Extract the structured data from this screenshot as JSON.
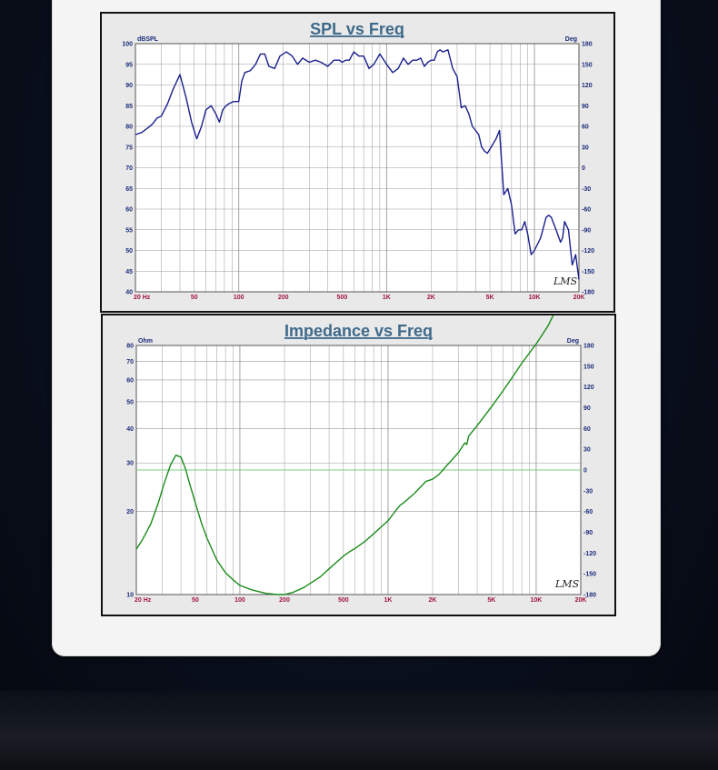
{
  "chart_data": [
    {
      "type": "line",
      "title": "SPL vs Freq",
      "x_scale": "log",
      "xlim": [
        20,
        20000
      ],
      "ylim": [
        40,
        100
      ],
      "y2lim": [
        -180,
        180
      ],
      "y_unit": "dBSPL",
      "y2_unit": "Deg",
      "x_ticks": [
        {
          "value": 20,
          "label": "20 Hz"
        },
        {
          "value": 50,
          "label": "50"
        },
        {
          "value": 100,
          "label": "100"
        },
        {
          "value": 200,
          "label": "200"
        },
        {
          "value": 500,
          "label": "500"
        },
        {
          "value": 1000,
          "label": "1K"
        },
        {
          "value": 2000,
          "label": "2K"
        },
        {
          "value": 5000,
          "label": "5K"
        },
        {
          "value": 10000,
          "label": "10K"
        },
        {
          "value": 20000,
          "label": "20K"
        }
      ],
      "y_ticks": [
        {
          "value": 40,
          "label": "40"
        },
        {
          "value": 45,
          "label": "45"
        },
        {
          "value": 50,
          "label": "50"
        },
        {
          "value": 55,
          "label": "55"
        },
        {
          "value": 60,
          "label": "60"
        },
        {
          "value": 65,
          "label": "65"
        },
        {
          "value": 70,
          "label": "70"
        },
        {
          "value": 75,
          "label": "75"
        },
        {
          "value": 80,
          "label": "80"
        },
        {
          "value": 85,
          "label": "85"
        },
        {
          "value": 90,
          "label": "90"
        },
        {
          "value": 95,
          "label": "95"
        },
        {
          "value": 100,
          "label": "100"
        }
      ],
      "y2_ticks": [
        {
          "value": 180,
          "label": "180"
        },
        {
          "value": 150,
          "label": "150"
        },
        {
          "value": 120,
          "label": "120"
        },
        {
          "value": 90,
          "label": "90"
        },
        {
          "value": 60,
          "label": "60"
        },
        {
          "value": 30,
          "label": "30"
        },
        {
          "value": 0,
          "label": "0"
        },
        {
          "value": -30,
          "label": "-30"
        },
        {
          "value": -60,
          "label": "-60"
        },
        {
          "value": -90,
          "label": "-90"
        },
        {
          "value": -120,
          "label": "-120"
        },
        {
          "value": -150,
          "label": "-150"
        },
        {
          "value": -180,
          "label": "-180"
        }
      ],
      "grid": true,
      "logo": "LMS",
      "colors": {
        "line": "#1a1f8c",
        "grid": "#9a9a9a",
        "plot_bg": "#ffffff"
      },
      "series": [
        {
          "x": [
            20,
            22,
            24,
            26,
            28,
            30,
            33,
            36,
            40,
            44,
            48,
            52,
            56,
            60,
            65,
            70,
            74,
            78,
            82,
            86,
            92,
            100,
            105,
            110,
            120,
            130,
            140,
            150,
            160,
            175,
            190,
            210,
            230,
            250,
            270,
            300,
            330,
            360,
            400,
            440,
            480,
            500,
            530,
            560,
            600,
            650,
            700,
            760,
            820,
            900,
            1000,
            1100,
            1200,
            1300,
            1400,
            1500,
            1600,
            1700,
            1800,
            1900,
            2000,
            2100,
            2200,
            2300,
            2400,
            2600,
            2800,
            3000,
            3200,
            3400,
            3600,
            3800,
            4000,
            4200,
            4400,
            4600,
            4800,
            5000,
            5200,
            5500,
            5800,
            6200,
            6600,
            7000,
            7400,
            7800,
            8200,
            8600,
            9000,
            9500,
            10000,
            11000,
            12000,
            12500,
            13000,
            14000,
            15000,
            15500,
            16000,
            17000,
            18000,
            19000,
            20000
          ],
          "y": [
            78,
            78.5,
            79.5,
            80.5,
            82,
            82.5,
            85.5,
            89,
            92.5,
            87,
            81,
            77,
            80,
            84,
            85,
            83,
            81,
            84,
            85,
            85.5,
            86,
            86,
            91,
            93,
            93.5,
            95,
            97.5,
            97.5,
            94.5,
            94,
            97,
            98,
            97,
            95,
            96.5,
            95.5,
            96,
            95.5,
            94.5,
            96,
            96,
            95.5,
            96,
            96,
            98,
            97,
            97,
            94,
            95,
            97.5,
            95,
            93,
            94,
            96.5,
            95,
            96,
            96,
            96.5,
            94.5,
            95.5,
            96,
            96,
            98,
            98.5,
            98,
            98.5,
            94,
            92,
            84.5,
            85,
            83,
            80,
            79,
            78,
            75,
            74,
            73.5,
            74.5,
            75.5,
            77,
            79,
            63.5,
            65,
            61,
            54,
            55,
            55,
            57,
            54,
            49,
            50,
            53,
            58,
            58.5,
            58,
            55,
            52,
            53,
            57,
            55,
            46.5,
            49,
            43
          ]
        }
      ]
    },
    {
      "type": "line",
      "title": "Impedance vs Freq",
      "x_scale": "log",
      "y_scale": "log",
      "xlim": [
        20,
        20000
      ],
      "ylim": [
        10,
        80
      ],
      "y2lim": [
        -180,
        180
      ],
      "y_unit": "Ohm",
      "y2_unit": "Deg",
      "x_ticks": [
        {
          "value": 20,
          "label": "20 Hz"
        },
        {
          "value": 50,
          "label": "50"
        },
        {
          "value": 100,
          "label": "100"
        },
        {
          "value": 200,
          "label": "200"
        },
        {
          "value": 500,
          "label": "500"
        },
        {
          "value": 1000,
          "label": "1K"
        },
        {
          "value": 2000,
          "label": "2K"
        },
        {
          "value": 5000,
          "label": "5K"
        },
        {
          "value": 10000,
          "label": "10K"
        },
        {
          "value": 20000,
          "label": "20K"
        }
      ],
      "y_ticks": [
        {
          "value": 10,
          "label": "10"
        },
        {
          "value": 20,
          "label": "20"
        },
        {
          "value": 30,
          "label": "30"
        },
        {
          "value": 40,
          "label": "40"
        },
        {
          "value": 50,
          "label": "50"
        },
        {
          "value": 60,
          "label": "60"
        },
        {
          "value": 70,
          "label": "70"
        },
        {
          "value": 80,
          "label": "80"
        }
      ],
      "y2_ticks": [
        {
          "value": 180,
          "label": "180"
        },
        {
          "value": 150,
          "label": "150"
        },
        {
          "value": 120,
          "label": "120"
        },
        {
          "value": 90,
          "label": "90"
        },
        {
          "value": 60,
          "label": "60"
        },
        {
          "value": 30,
          "label": "30"
        },
        {
          "value": 0,
          "label": "0"
        },
        {
          "value": -30,
          "label": "-30"
        },
        {
          "value": -60,
          "label": "-60"
        },
        {
          "value": -90,
          "label": "-90"
        },
        {
          "value": -120,
          "label": "-120"
        },
        {
          "value": -150,
          "label": "-150"
        },
        {
          "value": -180,
          "label": "-180"
        }
      ],
      "grid": true,
      "logo": "LMS",
      "colors": {
        "line": "#1a8c1a",
        "phase": "#7ccf7c",
        "grid": "#9a9a9a",
        "plot_bg": "#ffffff"
      },
      "series": [
        {
          "x": [
            20,
            22,
            25,
            28,
            31,
            34,
            37,
            40,
            43,
            46,
            50,
            55,
            60,
            70,
            80,
            90,
            100,
            120,
            150,
            180,
            200,
            230,
            270,
            300,
            350,
            400,
            450,
            500,
            550,
            600,
            700,
            800,
            900,
            1000,
            1100,
            1200,
            1300,
            1500,
            1800,
            2000,
            2200,
            2500,
            3000,
            3300,
            3400,
            3500,
            4000,
            5000,
            6000,
            7000,
            8000,
            10000,
            12000,
            15000,
            18000,
            20000
          ],
          "y": [
            14.6,
            15.8,
            18,
            21.3,
            25.5,
            29.5,
            32,
            31.5,
            28.5,
            25,
            21.5,
            18.2,
            16,
            13.3,
            12,
            11.3,
            10.8,
            10.4,
            10.1,
            10,
            10,
            10.2,
            10.6,
            11,
            11.6,
            12.4,
            13.1,
            13.8,
            14.3,
            14.7,
            15.6,
            16.6,
            17.6,
            18.5,
            19.8,
            21,
            21.7,
            23.2,
            25.7,
            26.2,
            27.2,
            29.4,
            32.8,
            35.5,
            35,
            37.5,
            41,
            48,
            55,
            62,
            69,
            81,
            94,
            120,
            137,
            147
          ]
        }
      ]
    }
  ]
}
